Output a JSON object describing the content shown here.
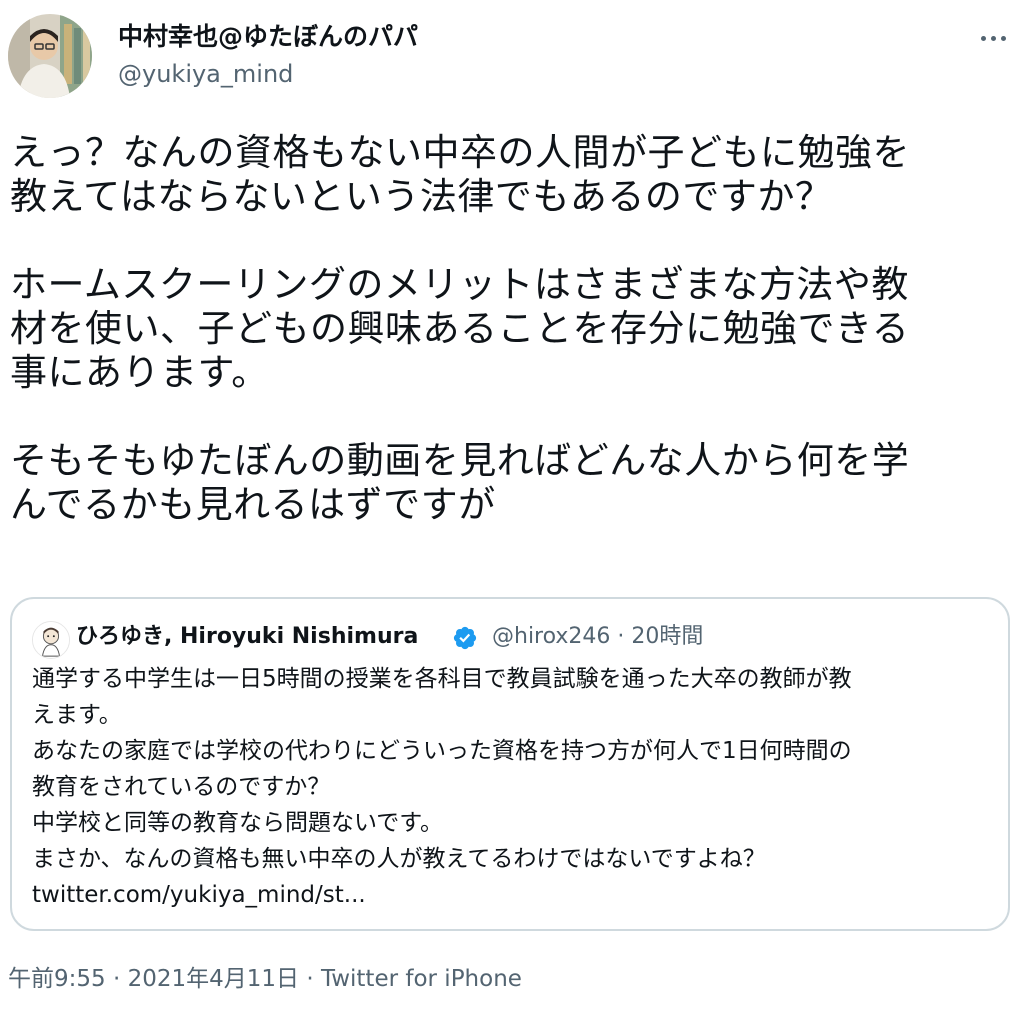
{
  "author": {
    "display_name": "中村幸也@ゆたぼんのパパ",
    "handle": "@yukiya_mind"
  },
  "tweet": {
    "lines": [
      "えっ？なんの資格もない中卒の人間が子どもに勉強を",
      "教えてはならないという法律でもあるのですか？",
      "",
      "ホームスクーリングのメリットはさまざまな方法や教",
      "材を使い、子どもの興味あることを存分に勉強できる",
      "事にあります。",
      "",
      "そもそもゆたぼんの動画を見ればどんな人から何を学",
      "んでるかも見れるはずですが"
    ]
  },
  "quote": {
    "display_name": "ひろゆき, Hiroyuki Nishimura",
    "handle": "@hirox246",
    "separator": "·",
    "time": "20時間",
    "verified": true,
    "lines": [
      "通学する中学生は一日5時間の授業を各科目で教員試験を通った大卒の教師が教",
      "えます。",
      "あなたの家庭では学校の代わりにどういった資格を持つ方が何人で1日何時間の",
      "教育をされているのですか？",
      "中学校と同等の教育なら問題ないです。",
      "まさか、なんの資格も無い中卒の人が教えてるわけではないですよね？",
      "twitter.com/yukiya_mind/st..."
    ]
  },
  "footer": {
    "time": "午前9:55",
    "sep1": "·",
    "date": "2021年4月11日",
    "sep2": "·",
    "source": "Twitter for iPhone"
  },
  "icons": {
    "more": "more-horizontal-icon",
    "verified": "verified-badge-icon"
  },
  "colors": {
    "text_primary": "#0f1419",
    "text_secondary": "#536471",
    "border": "#cfd9de",
    "verified": "#1d9bf0"
  }
}
